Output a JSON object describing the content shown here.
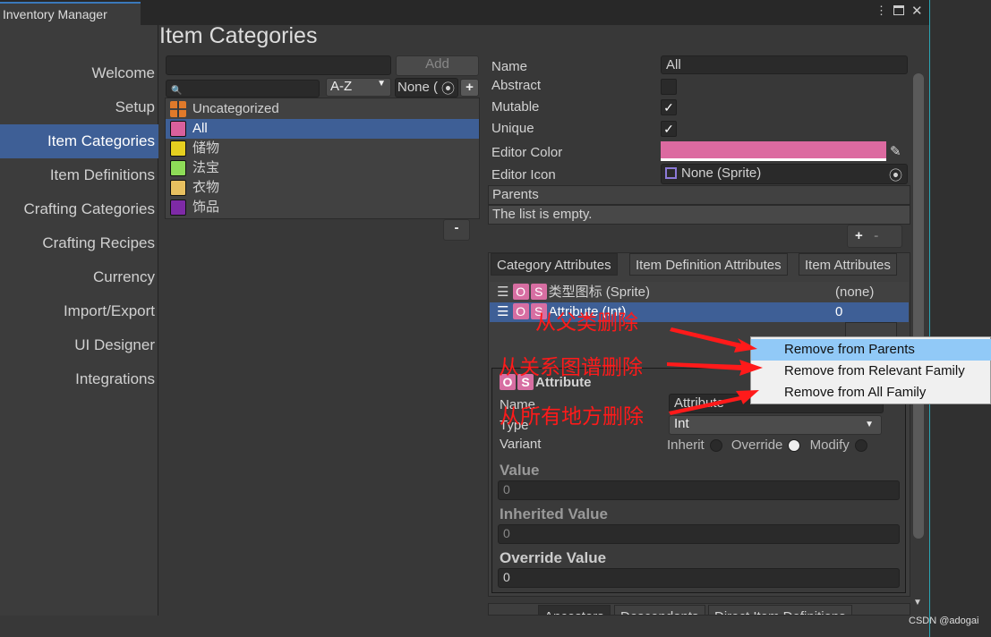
{
  "window": {
    "title": "Inventory Manager",
    "menu_icon": "kebab-icon",
    "max_icon": "maximize-icon",
    "close_icon": "close-icon"
  },
  "sidebar": {
    "items": [
      {
        "label": "Welcome"
      },
      {
        "label": "Setup"
      },
      {
        "label": "Item Categories",
        "selected": true
      },
      {
        "label": "Item Definitions"
      },
      {
        "label": "Crafting Categories"
      },
      {
        "label": "Crafting Recipes"
      },
      {
        "label": "Currency"
      },
      {
        "label": "Import/Export"
      },
      {
        "label": "UI Designer"
      },
      {
        "label": "Integrations"
      }
    ]
  },
  "main": {
    "title": "Item Categories",
    "new_name_value": "",
    "add_label": "Add",
    "search_value": "",
    "sort_value": "A-Z",
    "filter_value": "None (",
    "plus": "+",
    "minus": "-",
    "categories": [
      {
        "name": "Uncategorized",
        "color": "#e07a2a"
      },
      {
        "name": "All",
        "color": "#d9609c",
        "selected": true
      },
      {
        "name": "储物",
        "color": "#e6d020"
      },
      {
        "name": "法宝",
        "color": "#8edc58"
      },
      {
        "name": "衣物",
        "color": "#e8c060"
      },
      {
        "name": "饰品",
        "color": "#7e2aa6"
      }
    ]
  },
  "details": {
    "name_label": "Name",
    "name_value": "All",
    "abstract_label": "Abstract",
    "abstract": false,
    "mutable_label": "Mutable",
    "mutable": true,
    "unique_label": "Unique",
    "unique": true,
    "editor_color_label": "Editor Color",
    "editor_color": "#dc6aa0",
    "editor_icon_label": "Editor Icon",
    "editor_icon_value": "None (Sprite)",
    "parents_label": "Parents",
    "parents_empty": "The list is empty.",
    "check": "✓"
  },
  "attr_tabs": [
    "Category Attributes",
    "Item Definition Attributes",
    "Item Attributes"
  ],
  "attributes": [
    {
      "o": "O",
      "s": "S",
      "name": "类型图标 (Sprite)",
      "value": "(none)"
    },
    {
      "o": "O",
      "s": "S",
      "name": "Attribute (Int)",
      "value": "0",
      "selected": true
    }
  ],
  "attr_detail": {
    "title": "Attribute",
    "name_label": "Name",
    "name_value": "Attribute",
    "type_label": "Type",
    "type_value": "Int",
    "variant_label": "Variant",
    "variants": [
      {
        "label": "Inherit",
        "on": false
      },
      {
        "label": "Override",
        "on": true
      },
      {
        "label": "Modify",
        "on": false
      }
    ],
    "value_label": "Value",
    "value": "0",
    "inherited_label": "Inherited Value",
    "inherited": "0",
    "override_label": "Override Value",
    "override": "0"
  },
  "bottom_tabs": [
    "Ancestors",
    "Descendants",
    "Direct Item Definitions"
  ],
  "context_menu": [
    "Remove from Parents",
    "Remove from Relevant Family",
    "Remove from All Family"
  ],
  "annotations": [
    "从父类删除",
    "从关系图谱删除",
    "从所有地方删除"
  ],
  "watermark": "CSDN @adogai"
}
